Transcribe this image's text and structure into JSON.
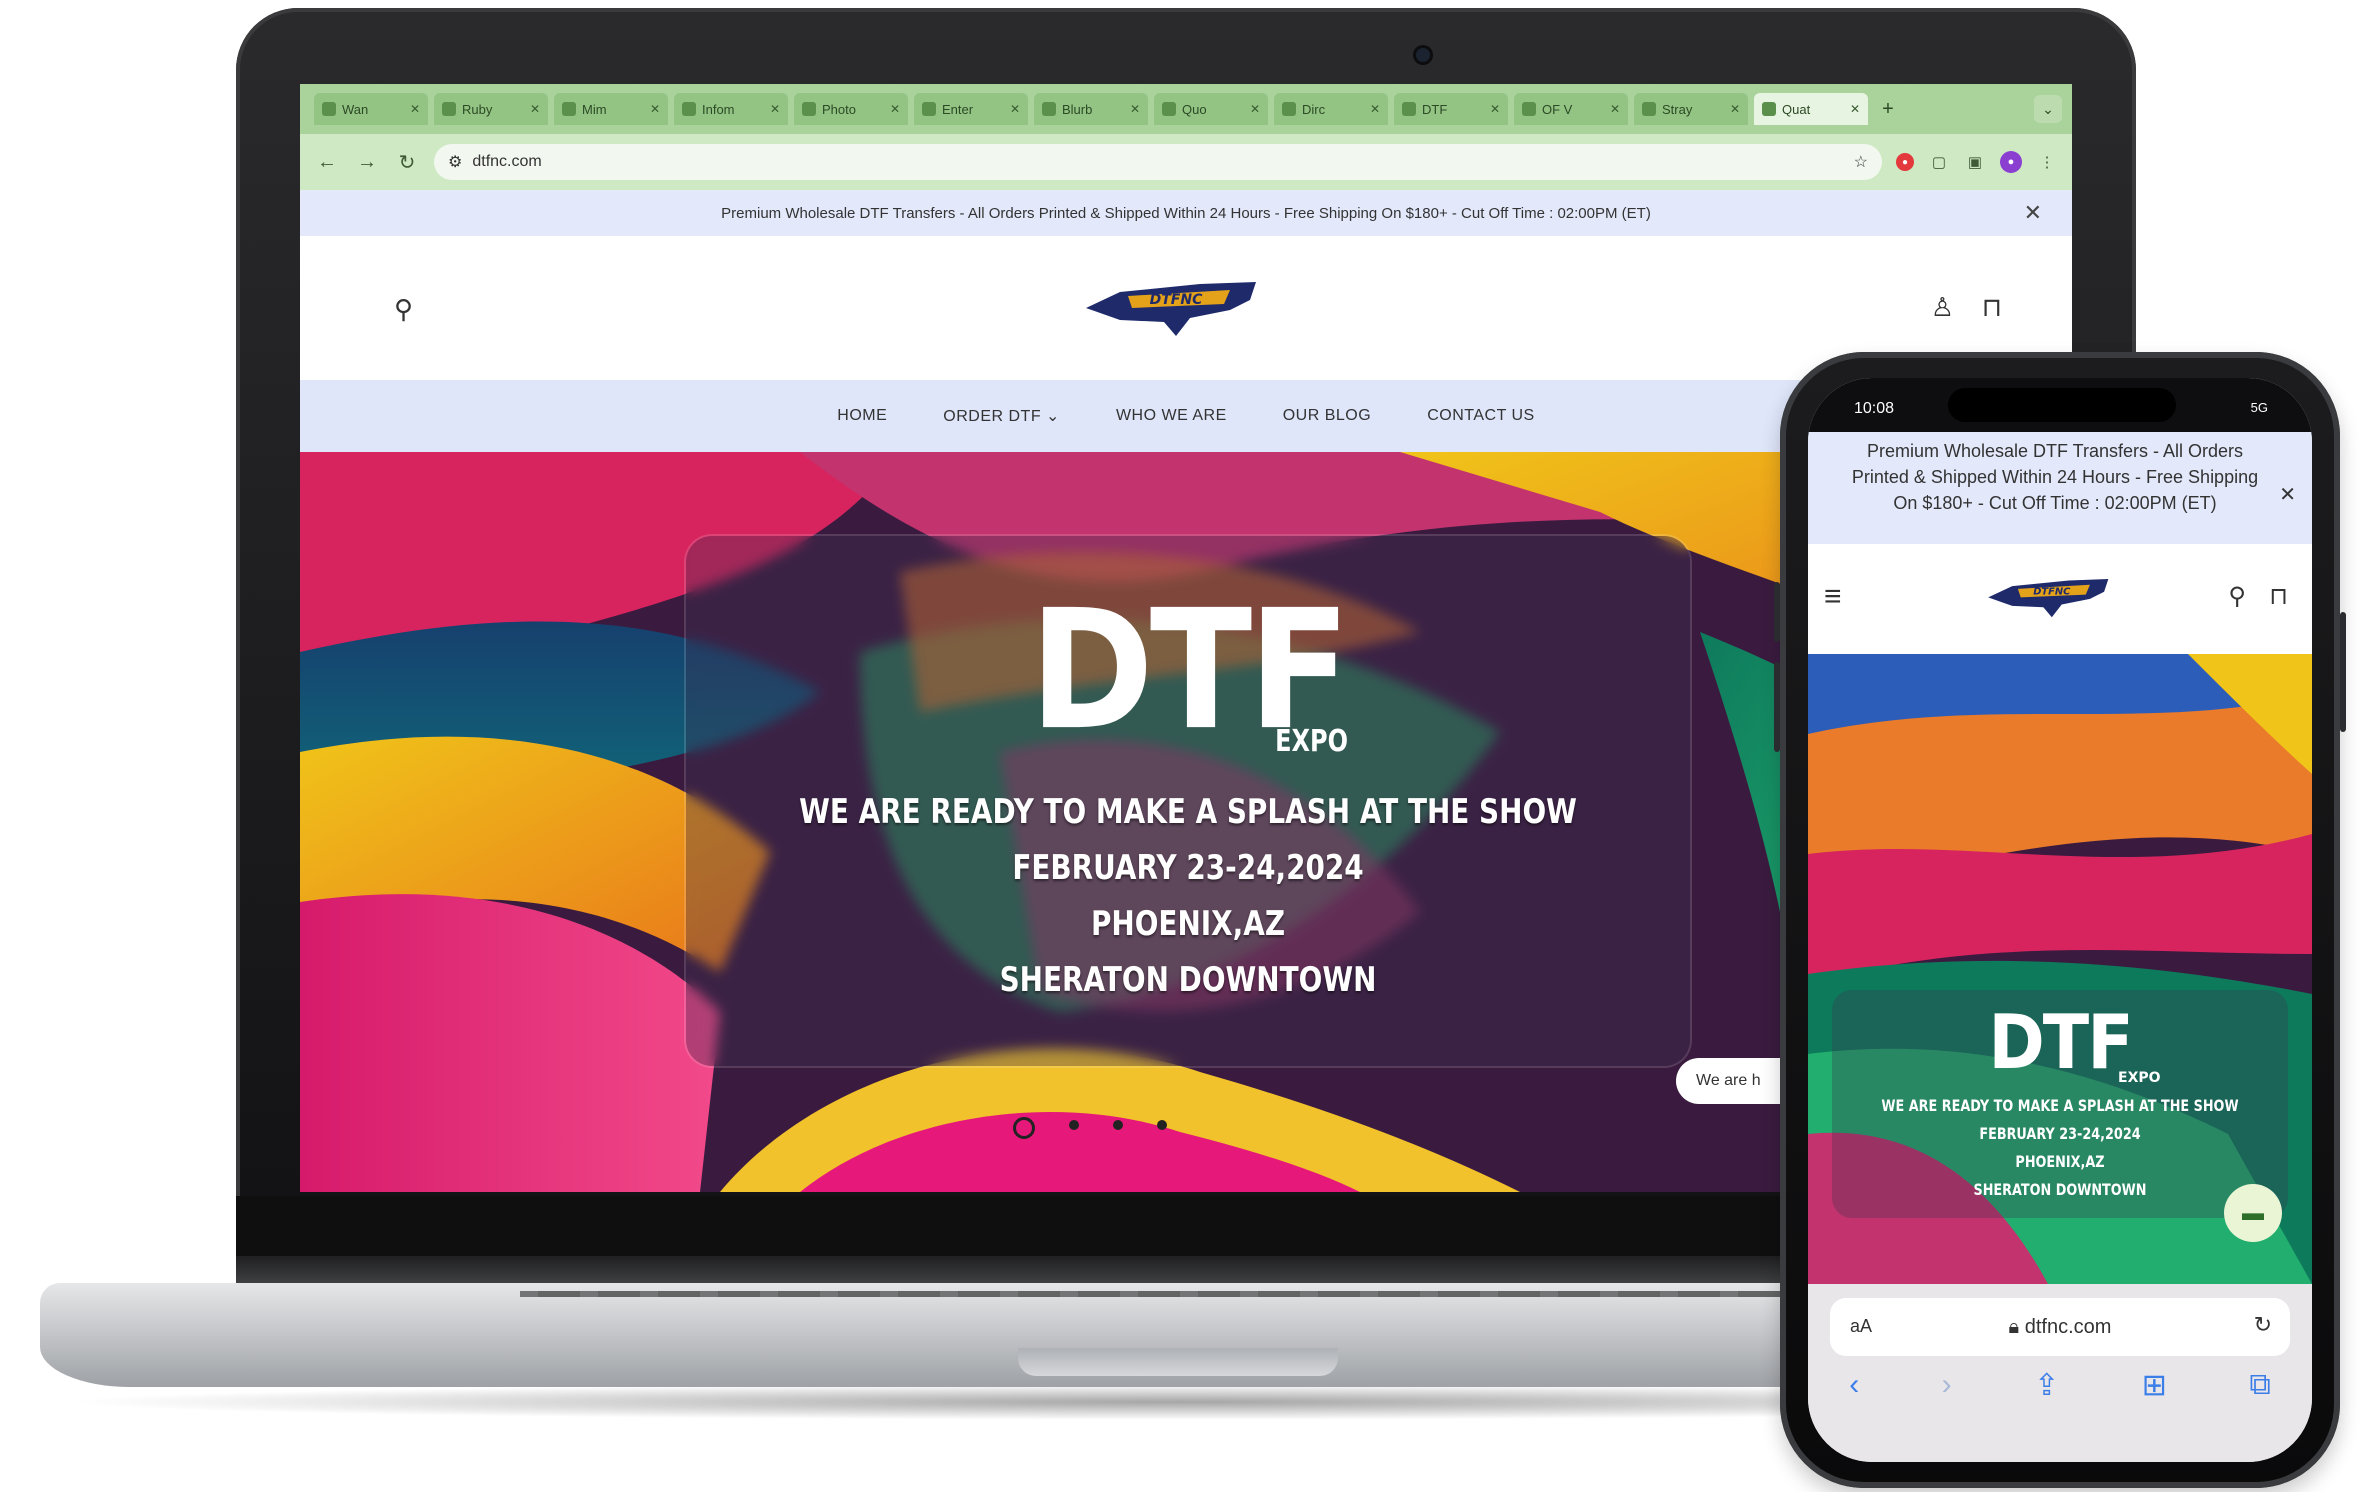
{
  "browser": {
    "tabs": [
      {
        "label": "Wan"
      },
      {
        "label": "Ruby"
      },
      {
        "label": "Mim"
      },
      {
        "label": "Infom"
      },
      {
        "label": "Photo"
      },
      {
        "label": "Enter"
      },
      {
        "label": "Blurb"
      },
      {
        "label": "Quo"
      },
      {
        "label": "Dirc"
      },
      {
        "label": "DTF"
      },
      {
        "label": "OF V"
      },
      {
        "label": "Stray"
      },
      {
        "label": "Quat"
      }
    ],
    "new_tab": "+",
    "url": "dtfnc.com"
  },
  "site": {
    "announcement": "Premium Wholesale DTF Transfers - All Orders Printed & Shipped Within 24 Hours - Free Shipping On $180+ - Cut Off Time : 02:00PM (ET)",
    "nav": [
      "HOME",
      "ORDER DTF ⌄",
      "WHO WE ARE",
      "OUR BLOG",
      "CONTACT US"
    ],
    "logo_text": "DTFNC",
    "hero": {
      "title": "DTF",
      "subtitle": "EXPO",
      "line1": "WE ARE READY TO MAKE A SPLASH AT THE SHOW",
      "line2": "FEBRUARY 23-24,2024",
      "line3": "PHOENIX,AZ",
      "line4": "SHERATON DOWNTOWN"
    },
    "chip": "We are h",
    "slides_total": 4,
    "slide_active": 1
  },
  "phone": {
    "time": "10:08",
    "status_right": "5G",
    "announcement": "Premium Wholesale DTF Transfers - All Orders Printed & Shipped Within 24 Hours - Free Shipping On $180+ - Cut Off Time : 02:00PM (ET)",
    "aa": "aA",
    "url": "dtfnc.com",
    "hero": {
      "title": "DTF",
      "subtitle": "EXPO",
      "line1": "WE ARE READY TO MAKE A SPLASH AT THE SHOW",
      "line2": "FEBRUARY 23-24,2024",
      "line3": "PHOENIX,AZ",
      "line4": "SHERATON DOWNTOWN"
    }
  },
  "colors": {
    "tabbar": "#a9d39b",
    "announce_bg": "#e3e9fb",
    "logo_navy": "#1f2a6b",
    "logo_gold": "#e3a21a"
  }
}
